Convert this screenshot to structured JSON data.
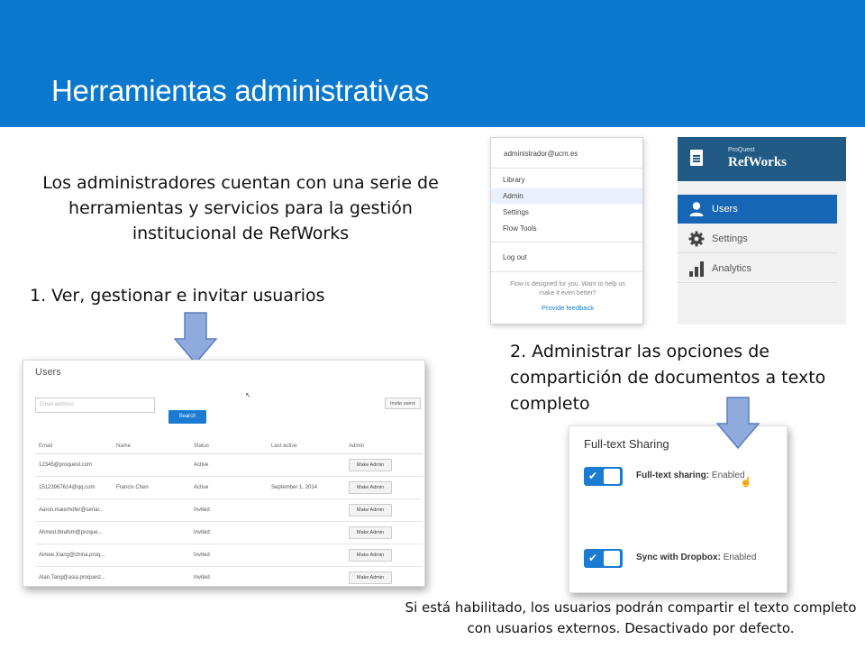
{
  "slide": {
    "title": "Herramientas administrativas",
    "intro": "Los administradores cuentan con una serie de herramientas y servicios para la gestión institucional de RefWorks",
    "step1": "1. Ver, gestionar e invitar usuarios",
    "step2": "2. Administrar las opciones de compartición de documentos a texto completo",
    "footnote": "Si está habilitado, los usuarios podrán compartir el texto completo con usuarios externos. Desactivado por defecto.",
    "colors": {
      "banner": "#0a78cc",
      "arrow": "#8faadc"
    }
  },
  "users_panel": {
    "title": "Users",
    "search_placeholder": "Email address",
    "search_button": "Search",
    "invite_button": "Invite users",
    "cursor": "↖",
    "columns": [
      "Email",
      "Name",
      "Status",
      "Last active",
      "Admin"
    ],
    "rows": [
      {
        "email": "12345@proquest.com",
        "name": "",
        "status": "Active",
        "last_active": "",
        "action": "Make Admin"
      },
      {
        "email": "15123967614@qq.com",
        "name": "Francis Chen",
        "status": "Active",
        "last_active": "September 1, 2014",
        "action": "Make Admin"
      },
      {
        "email": "Aaron.maierhofer@serial...",
        "name": "",
        "status": "Invited",
        "last_active": "",
        "action": "Make Admin"
      },
      {
        "email": "Ahmed.Ibrahim@proque...",
        "name": "",
        "status": "Invited",
        "last_active": "",
        "action": "Make Admin"
      },
      {
        "email": "Aimee.Xiang@china.proq...",
        "name": "",
        "status": "Invited",
        "last_active": "",
        "action": "Make Admin"
      },
      {
        "email": "Alan.Tang@asia.proquest...",
        "name": "",
        "status": "Invited",
        "last_active": "",
        "action": "Make Admin"
      }
    ]
  },
  "account_menu": {
    "email": "administrador@ucm.es",
    "items": [
      "Library",
      "Admin",
      "Settings",
      "Flow Tools"
    ],
    "active_item": "Admin",
    "logout": "Log out",
    "note": "Flow is designed for you. Want to help us make it even better?",
    "feedback_link": "Provide feedback"
  },
  "refworks_sidebar": {
    "brand_small": "ProQuest",
    "brand_large": "RefWorks",
    "items": [
      {
        "label": "Users",
        "icon": "user-icon",
        "active": true
      },
      {
        "label": "Settings",
        "icon": "gear-icon",
        "active": false
      },
      {
        "label": "Analytics",
        "icon": "bar-chart-icon",
        "active": false
      }
    ]
  },
  "fulltext_panel": {
    "title": "Full-text Sharing",
    "cursor": "☝",
    "toggles": [
      {
        "label": "Full-text sharing:",
        "value": "Enabled",
        "on": true
      },
      {
        "label": "Sync with Dropbox:",
        "value": "Enabled",
        "on": true
      }
    ]
  }
}
